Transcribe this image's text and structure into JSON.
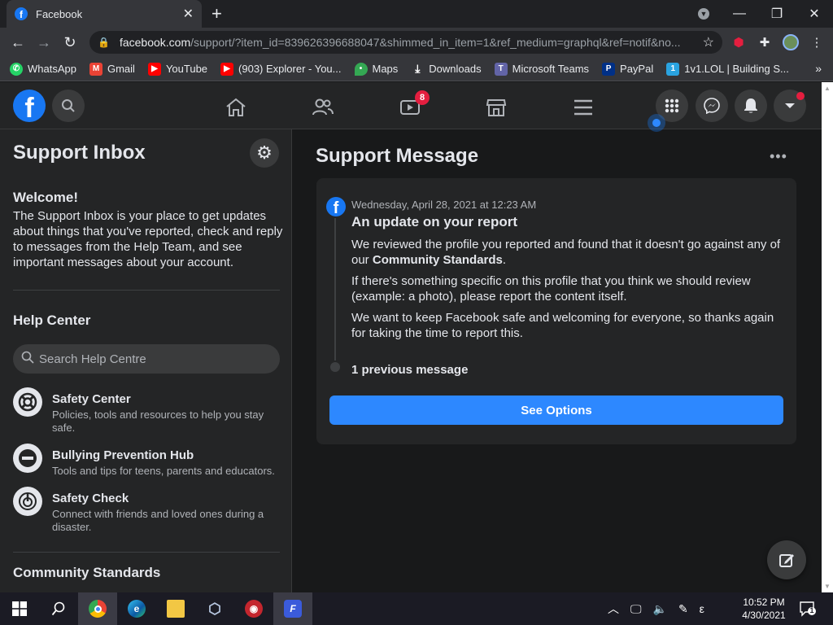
{
  "browser": {
    "tab_title": "Facebook",
    "new_tab": "+",
    "url_domain": "facebook.com",
    "url_path": "/support/?item_id=839626396688047&shimmed_in_item=1&ref_medium=graphql&ref=notif&no..."
  },
  "bookmarks": [
    {
      "label": "WhatsApp",
      "color": "#25d366"
    },
    {
      "label": "Gmail",
      "color": "#ea4335"
    },
    {
      "label": "YouTube",
      "color": "#ff0000"
    },
    {
      "label": "(903) Explorer - You...",
      "color": "#ff0000"
    },
    {
      "label": "Maps",
      "color": "#34a853"
    },
    {
      "label": "Downloads",
      "color": "#5f6368"
    },
    {
      "label": "Microsoft Teams",
      "color": "#6264a7"
    },
    {
      "label": "PayPal",
      "color": "#003087"
    },
    {
      "label": "1v1.LOL | Building S...",
      "color": "#2aa3e0"
    }
  ],
  "header": {
    "watch_badge": "8"
  },
  "sidebar": {
    "title": "Support Inbox",
    "welcome_heading": "Welcome!",
    "welcome_text": "The Support Inbox is your place to get updates about things that you've reported, check and reply to messages from the Help Team, and see important messages about your account.",
    "help_center_title": "Help Center",
    "search_placeholder": "Search Help Centre",
    "items": [
      {
        "title": "Safety Center",
        "desc": "Policies, tools and resources to help you stay safe."
      },
      {
        "title": "Bullying Prevention Hub",
        "desc": "Tools and tips for teens, parents and educators."
      },
      {
        "title": "Safety Check",
        "desc": "Connect with friends and loved ones during a disaster."
      }
    ],
    "community_title": "Community Standards"
  },
  "main": {
    "title": "Support Message",
    "more": "•••",
    "date": "Wednesday, April 28, 2021 at 12:23 AM",
    "heading": "An update on your report",
    "para1_pre": "We reviewed the profile you reported and found that it doesn't go against any of our ",
    "para1_bold": "Community Standards",
    "para1_post": ".",
    "para2": "If there's something specific on this profile that you think we should review (example: a photo), please report the content itself.",
    "para3": "We want to keep Facebook safe and welcoming for everyone, so thanks again for taking the time to report this.",
    "previous": "1 previous message",
    "button": "See Options"
  },
  "taskbar": {
    "time": "10:52 PM",
    "date": "4/30/2021",
    "lang": "ε",
    "notif_count": "1"
  }
}
